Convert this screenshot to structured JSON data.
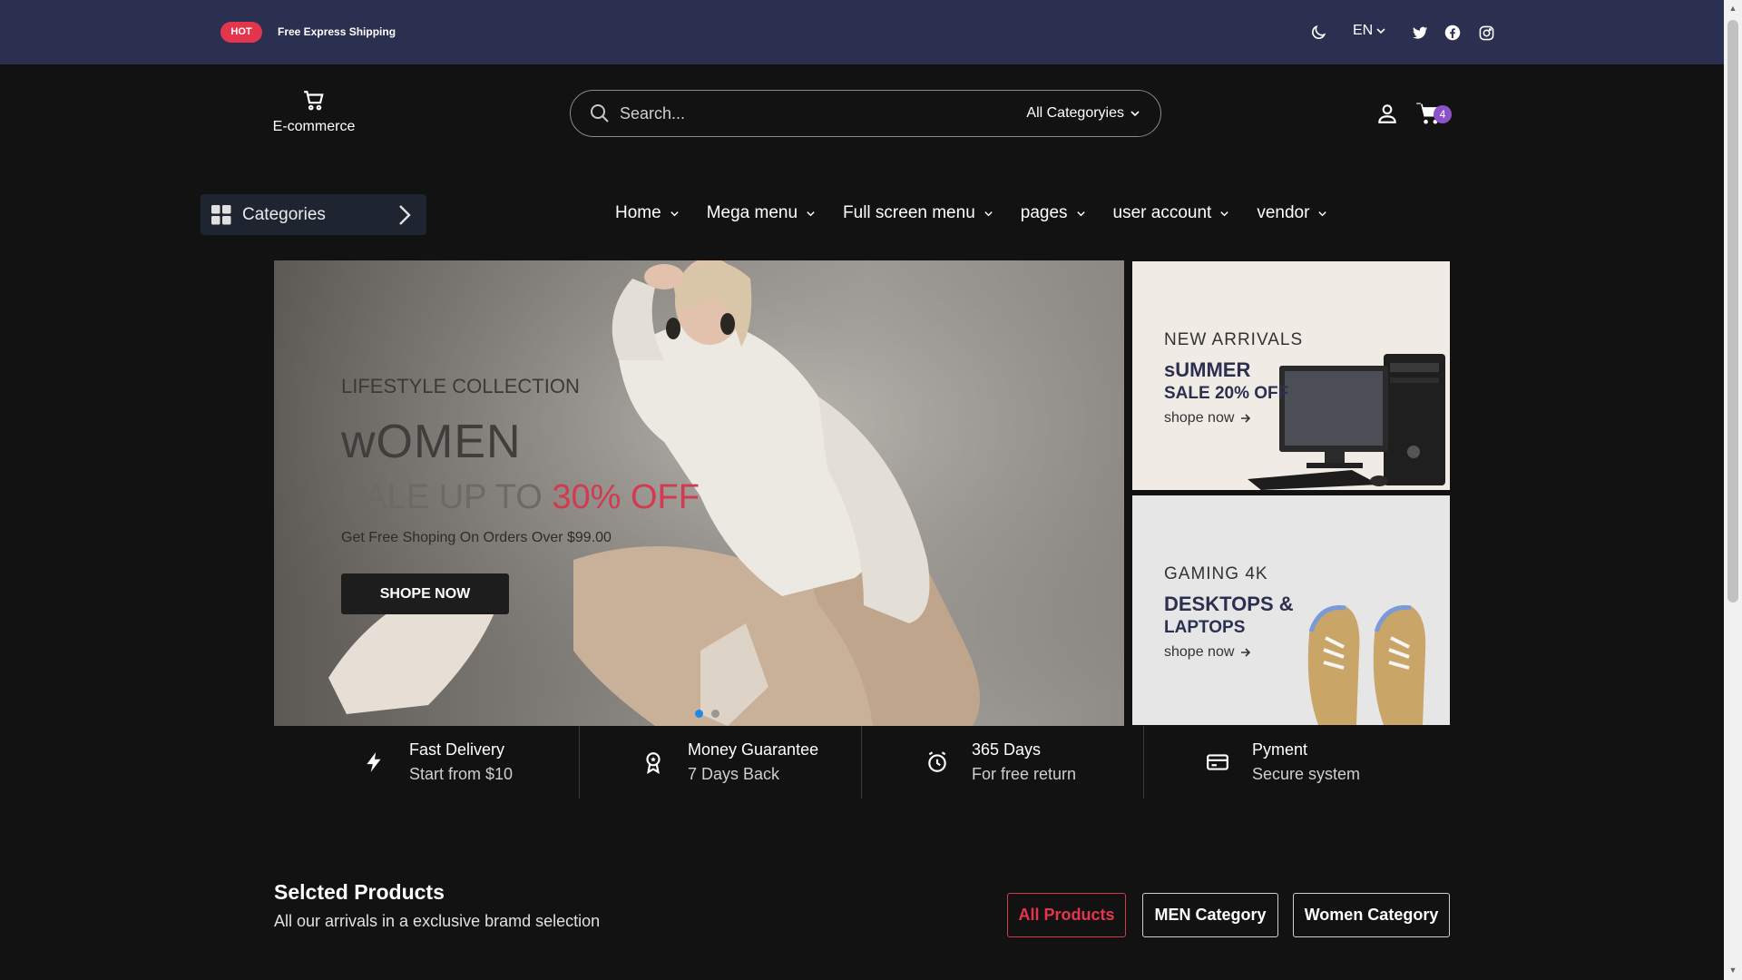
{
  "topbar": {
    "badge": "HOT",
    "text": "Free Express Shipping",
    "language": "EN",
    "icons": [
      "moon-icon",
      "twitter-icon",
      "facebook-icon",
      "instagram-icon"
    ]
  },
  "header": {
    "logo_text": "E-commerce",
    "search": {
      "placeholder": "Search...",
      "category": "All Categoryies"
    },
    "cart_count": "4"
  },
  "nav": {
    "categories_label": "Categories",
    "items": [
      {
        "label": "Home"
      },
      {
        "label": "Mega menu"
      },
      {
        "label": "Full screen menu"
      },
      {
        "label": "pages"
      },
      {
        "label": "user account"
      },
      {
        "label": "vendor"
      }
    ]
  },
  "hero": {
    "subtitle": "LIFESTYLE COLLECTION",
    "title": "wOMEN",
    "sale_prefix": "SALE UP TO ",
    "sale_accent": "30% OFF",
    "description": "Get Free Shoping On Orders Over $99.00",
    "button": "SHOPE NOW",
    "slide_count": 2,
    "active_slide": 1
  },
  "banners": [
    {
      "kicker": "NEW ARRIVALS",
      "title": "sUMMER",
      "subtitle": "SALE 20% OFF",
      "link": "shope now"
    },
    {
      "kicker": "GAMING 4K",
      "title": "DESKTOPS &",
      "subtitle": "LAPTOPS",
      "link": "shope now"
    }
  ],
  "features": [
    {
      "title": "Fast Delivery",
      "subtitle": "Start from $10",
      "icon": "lightning-icon"
    },
    {
      "title": "Money Guarantee",
      "subtitle": "7 Days Back",
      "icon": "award-icon"
    },
    {
      "title": "365 Days",
      "subtitle": "For free return",
      "icon": "alarm-clock-icon"
    },
    {
      "title": "Pyment",
      "subtitle": "Secure system",
      "icon": "credit-card-icon"
    }
  ],
  "products": {
    "title": "Selcted Products",
    "subtitle": "All our arrivals in a exclusive bramd selection",
    "filters": [
      "All Products",
      "MEN Category",
      "Women Category"
    ],
    "active_filter": "All Products"
  },
  "colors": {
    "topbar_bg": "#2b3050",
    "page_bg": "#121212",
    "accent_red": "#e3364e",
    "cart_badge": "#8c52c8",
    "active_dot": "#1e88e5"
  }
}
